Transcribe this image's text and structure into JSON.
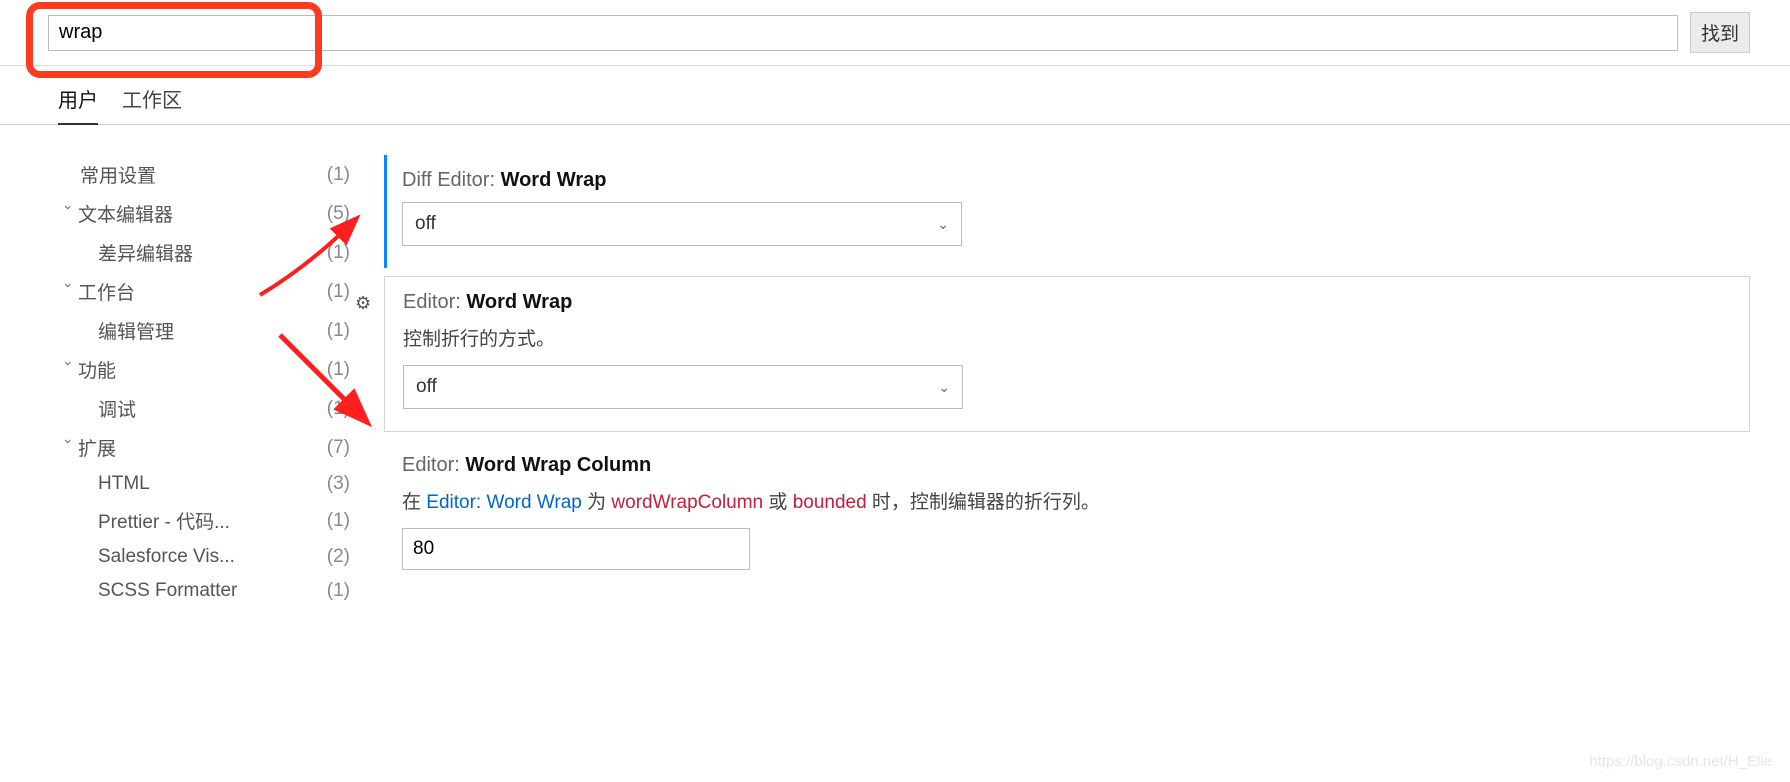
{
  "search": {
    "value": "wrap",
    "results_label": "找到"
  },
  "tabs": {
    "user": "用户",
    "workspace": "工作区"
  },
  "sidebar": {
    "common": {
      "label": "常用设置",
      "count": "(1)"
    },
    "text_editor": {
      "label": "文本编辑器",
      "count": "(5)"
    },
    "diff_editor": {
      "label": "差异编辑器",
      "count": "(1)"
    },
    "workbench": {
      "label": "工作台",
      "count": "(1)"
    },
    "editor_mgmt": {
      "label": "编辑管理",
      "count": "(1)"
    },
    "features": {
      "label": "功能",
      "count": "(1)"
    },
    "debug": {
      "label": "调试",
      "count": "(1)"
    },
    "extensions": {
      "label": "扩展",
      "count": "(7)"
    },
    "html": {
      "label": "HTML",
      "count": "(3)"
    },
    "prettier": {
      "label": "Prettier - 代码...",
      "count": "(1)"
    },
    "salesforce": {
      "label": "Salesforce Vis...",
      "count": "(2)"
    },
    "scss": {
      "label": "SCSS Formatter",
      "count": "(1)"
    }
  },
  "settings": {
    "diff_ww": {
      "prefix": "Diff Editor: ",
      "name": "Word Wrap",
      "value": "off"
    },
    "editor_ww": {
      "prefix": "Editor: ",
      "name": "Word Wrap",
      "desc": "控制折行的方式。",
      "value": "off"
    },
    "ww_column": {
      "prefix": "Editor: ",
      "name": "Word Wrap Column",
      "desc_1": "在 ",
      "link": "Editor: Word Wrap",
      "desc_2": " 为 ",
      "code1": "wordWrapColumn",
      "desc_3": " 或 ",
      "code2": "bounded",
      "desc_4": " 时，控制编辑器的折行列。",
      "value": "80"
    }
  },
  "watermark": "https://blog.csdn.net/H_Elie"
}
